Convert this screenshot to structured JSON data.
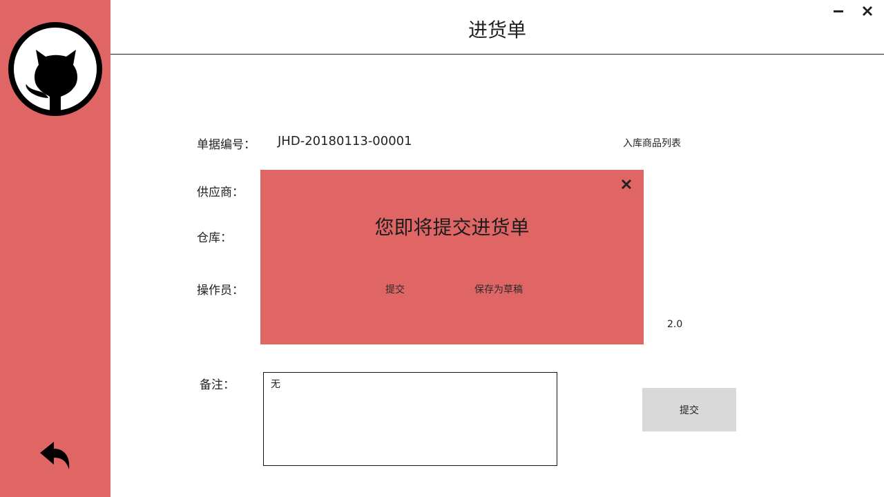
{
  "header": {
    "title": "进货单",
    "minimize_icon": "minimize-icon",
    "close_icon": "close-icon"
  },
  "sidebar": {
    "logo_icon": "github-octocat-icon",
    "back_icon": "back-arrow-icon",
    "background": "#e06666"
  },
  "form": {
    "doc_number_label": "单据编号：",
    "doc_number_value": "JHD-20180113-00001",
    "supplier_label": "供应商：",
    "warehouse_label": "仓库：",
    "operator_label": "操作员：",
    "item_list_link": "入库商品列表",
    "total_value": "2.0",
    "remark_label": "备注：",
    "remark_value": "无",
    "submit_label": "提交"
  },
  "modal": {
    "title": "您即将提交进货单",
    "submit_label": "提交",
    "draft_label": "保存为草稿",
    "close_icon": "close-icon",
    "background": "#e06666"
  }
}
